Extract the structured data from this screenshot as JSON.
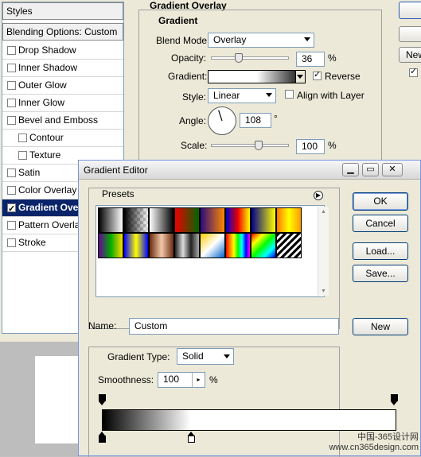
{
  "styles_panel": {
    "header": "Styles",
    "blending": "Blending Options: Custom",
    "items": [
      {
        "label": "Drop Shadow",
        "checked": false
      },
      {
        "label": "Inner Shadow",
        "checked": false
      },
      {
        "label": "Outer Glow",
        "checked": false
      },
      {
        "label": "Inner Glow",
        "checked": false
      },
      {
        "label": "Bevel and Emboss",
        "checked": false
      },
      {
        "label": "Contour",
        "checked": false
      },
      {
        "label": "Texture",
        "checked": false
      },
      {
        "label": "Satin",
        "checked": false
      },
      {
        "label": "Color Overlay",
        "checked": false
      },
      {
        "label": "Gradient Overlay",
        "checked": true
      },
      {
        "label": "Pattern Overlay",
        "checked": false
      },
      {
        "label": "Stroke",
        "checked": false
      }
    ]
  },
  "gradient_overlay": {
    "section_title": "Gradient Overlay",
    "group_title": "Gradient",
    "blend_mode_label": "Blend Mode:",
    "blend_mode_value": "Overlay",
    "opacity_label": "Opacity:",
    "opacity_value": "36",
    "opacity_unit": "%",
    "opacity_fraction": 0.36,
    "gradient_label": "Gradient:",
    "reverse_label": "Reverse",
    "reverse_checked": true,
    "style_label": "Style:",
    "style_value": "Linear",
    "align_label": "Align with Layer",
    "align_checked": false,
    "angle_label": "Angle:",
    "angle_value": "108",
    "angle_unit": "°",
    "scale_label": "Scale:",
    "scale_value": "100",
    "scale_unit": "%"
  },
  "right_buttons": {
    "new_label": "New"
  },
  "gradient_editor": {
    "title": "Gradient Editor",
    "presets_label": "Presets",
    "ok_label": "OK",
    "cancel_label": "Cancel",
    "load_label": "Load...",
    "save_label": "Save...",
    "name_label": "Name:",
    "name_value": "Custom",
    "new_label": "New",
    "gradient_type_label": "Gradient Type:",
    "gradient_type_value": "Solid",
    "smoothness_label": "Smoothness:",
    "smoothness_value": "100",
    "smoothness_unit": "%"
  },
  "watermark": {
    "line1": "中国-365设计网",
    "line2": "www.cn365design.com"
  }
}
